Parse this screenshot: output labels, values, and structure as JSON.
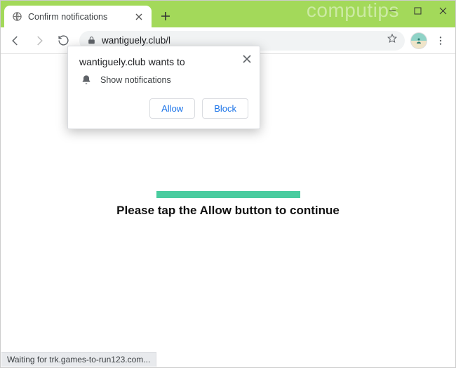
{
  "window": {
    "watermark": "computips"
  },
  "tab": {
    "title": "Confirm notifications"
  },
  "toolbar": {
    "url": "wantiguely.club/l"
  },
  "permission": {
    "title": "wantiguely.club wants to",
    "item": "Show notifications",
    "allow": "Allow",
    "block": "Block"
  },
  "page": {
    "message": "Please tap the Allow button to continue"
  },
  "status": {
    "text": "Waiting for trk.games-to-run123.com..."
  }
}
